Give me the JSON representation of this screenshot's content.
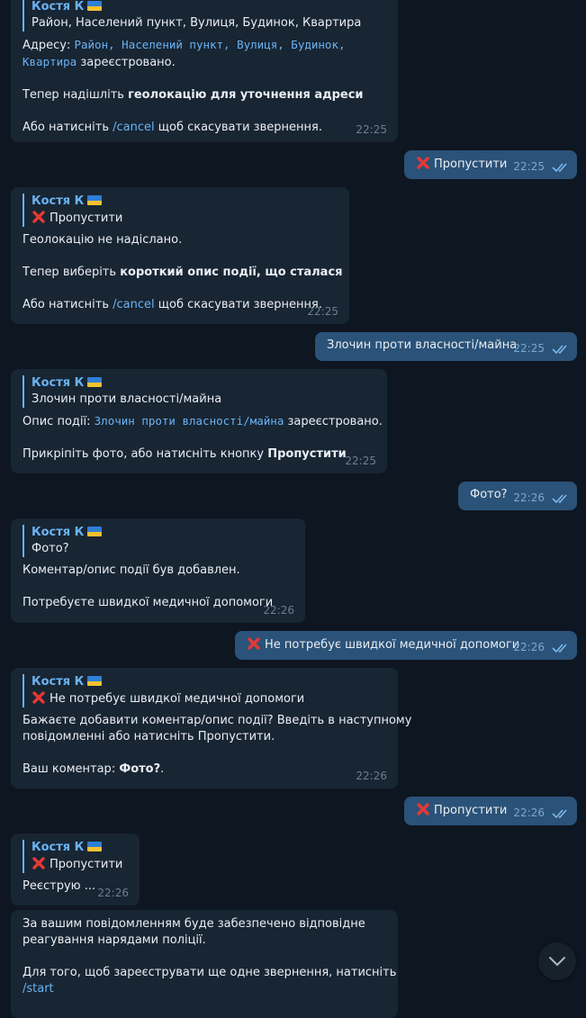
{
  "reply_author": "Костя К",
  "colors": {
    "background": "#0e1621",
    "incoming": "#182533",
    "outgoing": "#2b5278",
    "accent": "#6ab3f3",
    "cross": "#e53935"
  },
  "icons": [
    "flag-ua-icon",
    "cross-mark-icon",
    "double-check-icon",
    "chevron-down-icon"
  ],
  "m1": {
    "reply_text": "Район, Населений пункт, Вулиця, Будинок, Квартира",
    "l1_a": "Адресу: ",
    "l1_mono": "Район, Населений пункт, Вулиця, Будинок,",
    "l2_mono": "Квартира",
    "l2_b": " зареєстровано.",
    "l3_a": "Тепер надішліть ",
    "l3_bold": "геолокацію для уточнення адреси",
    "l4_a": "Або натисніть ",
    "l4_link": "/cancel",
    "l4_b": " щоб скасувати звернення.",
    "time": "22:25"
  },
  "o1": {
    "text": "Пропустити",
    "time": "22:25"
  },
  "m2": {
    "reply_text": "Пропустити",
    "l1": "Геолокацію не надіслано.",
    "l2_a": "Тепер виберіть ",
    "l2_bold": "короткий опис події, що сталася",
    "l3_a": "Або натисніть ",
    "l3_link": "/cancel",
    "l3_b": " щоб скасувати звернення.",
    "time": "22:25"
  },
  "o2": {
    "text": "Злочин проти власності/майна",
    "time": "22:25"
  },
  "m3": {
    "reply_text": "Злочин проти власності/майна",
    "l1_a": "Опис події: ",
    "l1_mono": "Злочин проти власності/майна",
    "l1_b": " зареєстровано.",
    "l2_a": "Прикріпіть фото, або натисніть кнопку ",
    "l2_bold": "Пропустити",
    "time": "22:25"
  },
  "o3": {
    "text": "Фото?",
    "time": "22:26"
  },
  "m4": {
    "reply_text": "Фото?",
    "l1": "Коментар/опис події був добавлен.",
    "l2": "Потребуєте швидкої медичної допомоги",
    "time": "22:26"
  },
  "o4": {
    "text": "Не потребує швидкої медичної допомоги",
    "time": "22:26"
  },
  "m5": {
    "reply_text": "Не потребує швидкої медичної допомоги",
    "l1": "Бажаєте добавити коментар/опис події? Введіть в наступному",
    "l2": "повідомленні або натисніть Пропустити.",
    "l3_a": "Ваш коментар: ",
    "l3_bold": "Фото?",
    "l3_b": ".",
    "time": "22:26"
  },
  "o5": {
    "text": "Пропустити",
    "time": "22:26"
  },
  "m6": {
    "reply_text": "Пропустити",
    "l1": "Реєструю ...",
    "time": "22:26"
  },
  "m7": {
    "l1": "За вашим повідомленням буде забезпечено відповідне",
    "l2": "реагування нарядами поліції.",
    "l3": "Для того, щоб зареєструвати ще одне звернення, натисніть",
    "l4_link": "/start"
  }
}
